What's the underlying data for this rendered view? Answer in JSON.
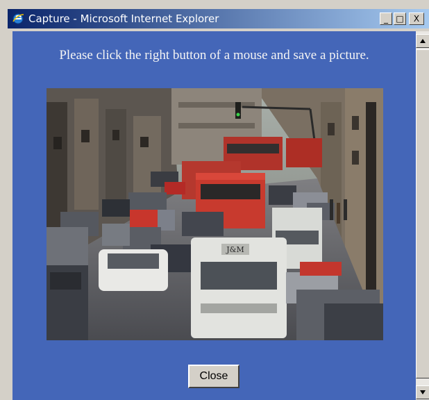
{
  "window": {
    "title": "Capture - Microsoft Internet Explorer",
    "icon": "internet-explorer-icon",
    "minimize_label": "_",
    "maximize_label": "□",
    "close_label": "X"
  },
  "content": {
    "caption": "Please click the right button of a mouse and save a picture.",
    "photo": {
      "description": "camera-capture-photo",
      "sign_text": "J&M"
    },
    "close_button_label": "Close"
  },
  "scrollbar": {
    "up_icon": "scroll-up-arrow-icon",
    "down_icon": "scroll-down-arrow-icon"
  },
  "colors": {
    "page_background": "#4466b8",
    "titlebar_start": "#0a246a",
    "titlebar_end": "#a6caf0",
    "caption_text": "#f4f4f4"
  }
}
